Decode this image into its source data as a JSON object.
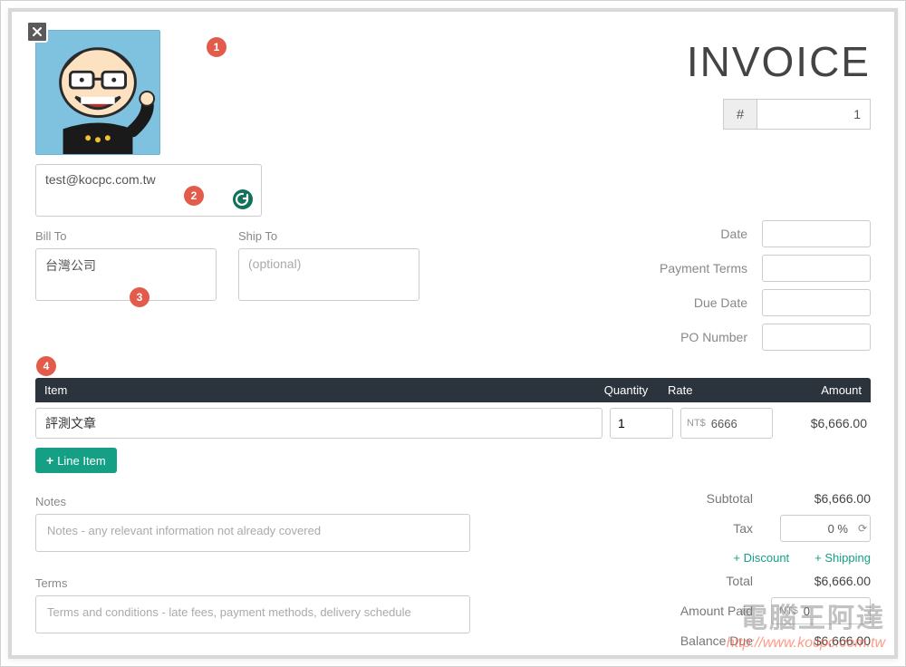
{
  "title": "INVOICE",
  "invoice_number_label": "#",
  "invoice_number": "1",
  "from_email": "test@kocpc.com.tw",
  "bill_to_label": "Bill To",
  "bill_to_value": "台灣公司",
  "ship_to_label": "Ship To",
  "ship_to_placeholder": "(optional)",
  "meta": {
    "date_label": "Date",
    "payment_terms_label": "Payment Terms",
    "due_date_label": "Due Date",
    "po_number_label": "PO Number"
  },
  "columns": {
    "item": "Item",
    "quantity": "Quantity",
    "rate": "Rate",
    "amount": "Amount"
  },
  "line_item": {
    "name": "評測文章",
    "quantity": "1",
    "rate_prefix": "NT$",
    "rate": "6666",
    "amount": "$6,666.00"
  },
  "add_line_item_label": "Line Item",
  "notes_label": "Notes",
  "notes_placeholder": "Notes - any relevant information not already covered",
  "terms_label": "Terms",
  "terms_placeholder": "Terms and conditions - late fees, payment methods, delivery schedule",
  "totals": {
    "subtotal_label": "Subtotal",
    "subtotal": "$6,666.00",
    "tax_label": "Tax",
    "tax_value": "0 %",
    "discount_label": "Discount",
    "shipping_label": "Shipping",
    "total_label": "Total",
    "total": "$6,666.00",
    "amount_paid_label": "Amount Paid",
    "amount_paid_prefix": "NT$",
    "amount_paid": "0",
    "balance_due_label": "Balance Due",
    "balance_due": "$6,666.00"
  },
  "badges": {
    "b1": "1",
    "b2": "2",
    "b3": "3",
    "b4": "4"
  },
  "watermark": {
    "text": "電腦王阿達",
    "url": "http://www.kocpc.com.tw"
  }
}
